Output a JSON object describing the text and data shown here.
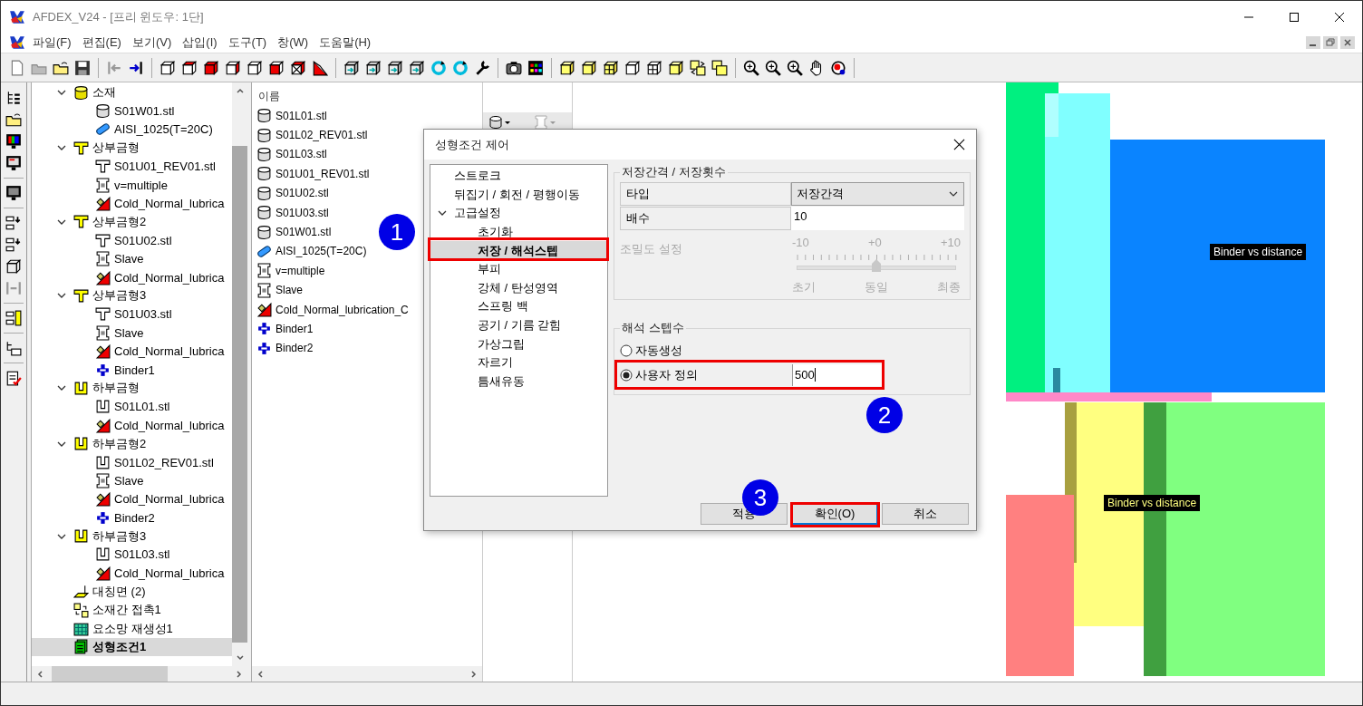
{
  "window": {
    "title": "AFDEX_V24 - [프리 윈도우: 1단]"
  },
  "menu": [
    "파일(F)",
    "편집(E)",
    "보기(V)",
    "삽입(I)",
    "도구(T)",
    "창(W)",
    "도움말(H)"
  ],
  "model_tree": {
    "items": [
      {
        "label": "소재",
        "kind": "material",
        "expanded": true,
        "selected": false,
        "children": [
          {
            "label": "S01W01.stl",
            "kind": "mesh",
            "selected": false
          },
          {
            "label": "AISI_1025(T=20C)",
            "kind": "steel",
            "selected": false
          }
        ]
      },
      {
        "label": "상부금형",
        "kind": "upper-die",
        "expanded": true,
        "selected": false,
        "children": [
          {
            "label": "S01U01_REV01.stl",
            "kind": "punch",
            "selected": false
          },
          {
            "label": "v=multiple",
            "kind": "press",
            "selected": false
          },
          {
            "label": "Cold_Normal_lubrica",
            "kind": "lubricant",
            "selected": false
          }
        ]
      },
      {
        "label": "상부금형2",
        "kind": "upper-die",
        "expanded": true,
        "selected": false,
        "children": [
          {
            "label": "S01U02.stl",
            "kind": "punch",
            "selected": false
          },
          {
            "label": "Slave",
            "kind": "press",
            "selected": false
          },
          {
            "label": "Cold_Normal_lubrica",
            "kind": "lubricant",
            "selected": false
          }
        ]
      },
      {
        "label": "상부금형3",
        "kind": "upper-die",
        "expanded": true,
        "selected": false,
        "children": [
          {
            "label": "S01U03.stl",
            "kind": "punch",
            "selected": false
          },
          {
            "label": "Slave",
            "kind": "press",
            "selected": false
          },
          {
            "label": "Cold_Normal_lubrica",
            "kind": "lubricant",
            "selected": false
          },
          {
            "label": "Binder1",
            "kind": "binder",
            "selected": false
          }
        ]
      },
      {
        "label": "하부금형",
        "kind": "lower-die",
        "expanded": true,
        "selected": false,
        "children": [
          {
            "label": "S01L01.stl",
            "kind": "lower-mesh",
            "selected": false
          },
          {
            "label": "Cold_Normal_lubrica",
            "kind": "lubricant",
            "selected": false
          }
        ]
      },
      {
        "label": "하부금형2",
        "kind": "lower-die",
        "expanded": true,
        "selected": false,
        "children": [
          {
            "label": "S01L02_REV01.stl",
            "kind": "lower-mesh",
            "selected": false
          },
          {
            "label": "Slave",
            "kind": "press",
            "selected": false
          },
          {
            "label": "Cold_Normal_lubrica",
            "kind": "lubricant",
            "selected": false
          },
          {
            "label": "Binder2",
            "kind": "binder",
            "selected": false
          }
        ]
      },
      {
        "label": "하부금형3",
        "kind": "lower-die",
        "expanded": true,
        "selected": false,
        "children": [
          {
            "label": "S01L03.stl",
            "kind": "lower-mesh",
            "selected": false
          },
          {
            "label": "Cold_Normal_lubrica",
            "kind": "lubricant",
            "selected": false
          }
        ]
      },
      {
        "label": "대칭면 (2)",
        "kind": "plane",
        "selected": false
      },
      {
        "label": "소재간 접촉1",
        "kind": "contact",
        "selected": false
      },
      {
        "label": "요소망 재생성1",
        "kind": "remesh",
        "selected": false
      },
      {
        "label": "성형조건1",
        "kind": "condition",
        "selected": true
      }
    ]
  },
  "object_list": {
    "header": "이름",
    "items": [
      {
        "label": "S01L01.stl",
        "kind": "mesh"
      },
      {
        "label": "S01L02_REV01.stl",
        "kind": "mesh"
      },
      {
        "label": "S01L03.stl",
        "kind": "mesh"
      },
      {
        "label": "S01U01_REV01.stl",
        "kind": "mesh"
      },
      {
        "label": "S01U02.stl",
        "kind": "mesh"
      },
      {
        "label": "S01U03.stl",
        "kind": "mesh"
      },
      {
        "label": "S01W01.stl",
        "kind": "mesh"
      },
      {
        "label": "AISI_1025(T=20C)",
        "kind": "steel"
      },
      {
        "label": "v=multiple",
        "kind": "press"
      },
      {
        "label": "Slave",
        "kind": "press"
      },
      {
        "label": "Cold_Normal_lubrication_C",
        "kind": "lubricant"
      },
      {
        "label": "Binder1",
        "kind": "binder"
      },
      {
        "label": "Binder2",
        "kind": "binder"
      }
    ]
  },
  "viewport": {
    "labels": [
      "Binder vs distance",
      "Binder vs distance"
    ]
  },
  "dialog": {
    "title": "성형조건 제어",
    "nav": [
      {
        "label": "스트로크",
        "selected": false
      },
      {
        "label": "뒤집기 / 회전 / 평행이동",
        "selected": false
      },
      {
        "label": "고급설정",
        "selected": false,
        "expanded": true,
        "children": [
          {
            "label": "초기화",
            "selected": false
          },
          {
            "label": "저장 / 해석스텝",
            "selected": true
          },
          {
            "label": "부피",
            "selected": false
          },
          {
            "label": "강체 / 탄성영역",
            "selected": false
          },
          {
            "label": "스프링 백",
            "selected": false
          },
          {
            "label": "공기 / 기름 갇힘",
            "selected": false
          },
          {
            "label": "가상그립",
            "selected": false
          },
          {
            "label": "자르기",
            "selected": false
          },
          {
            "label": "틈새유동",
            "selected": false
          }
        ]
      }
    ],
    "save_group": {
      "title": "저장간격 / 저장횟수",
      "type_label": "타입",
      "type_value": "저장간격",
      "multiplier_label": "배수",
      "multiplier_value": "10",
      "density": {
        "label": "조밀도 설정",
        "disabled": true,
        "ticks": [
          "-10",
          "+0",
          "+10"
        ],
        "captions": [
          "초기",
          "동일",
          "최종"
        ],
        "level": 0.5
      }
    },
    "steps_group": {
      "title": "해석 스텝수",
      "options": [
        {
          "label": "자동생성",
          "selected": false
        },
        {
          "label": "사용자 정의",
          "selected": true,
          "value": "500"
        }
      ]
    },
    "buttons": [
      {
        "label": "적용",
        "default": false
      },
      {
        "label": "확인(O)",
        "default": true
      },
      {
        "label": "취소",
        "default": false
      }
    ]
  },
  "annotations": [
    {
      "number": "1"
    },
    {
      "number": "2"
    },
    {
      "number": "3"
    }
  ]
}
